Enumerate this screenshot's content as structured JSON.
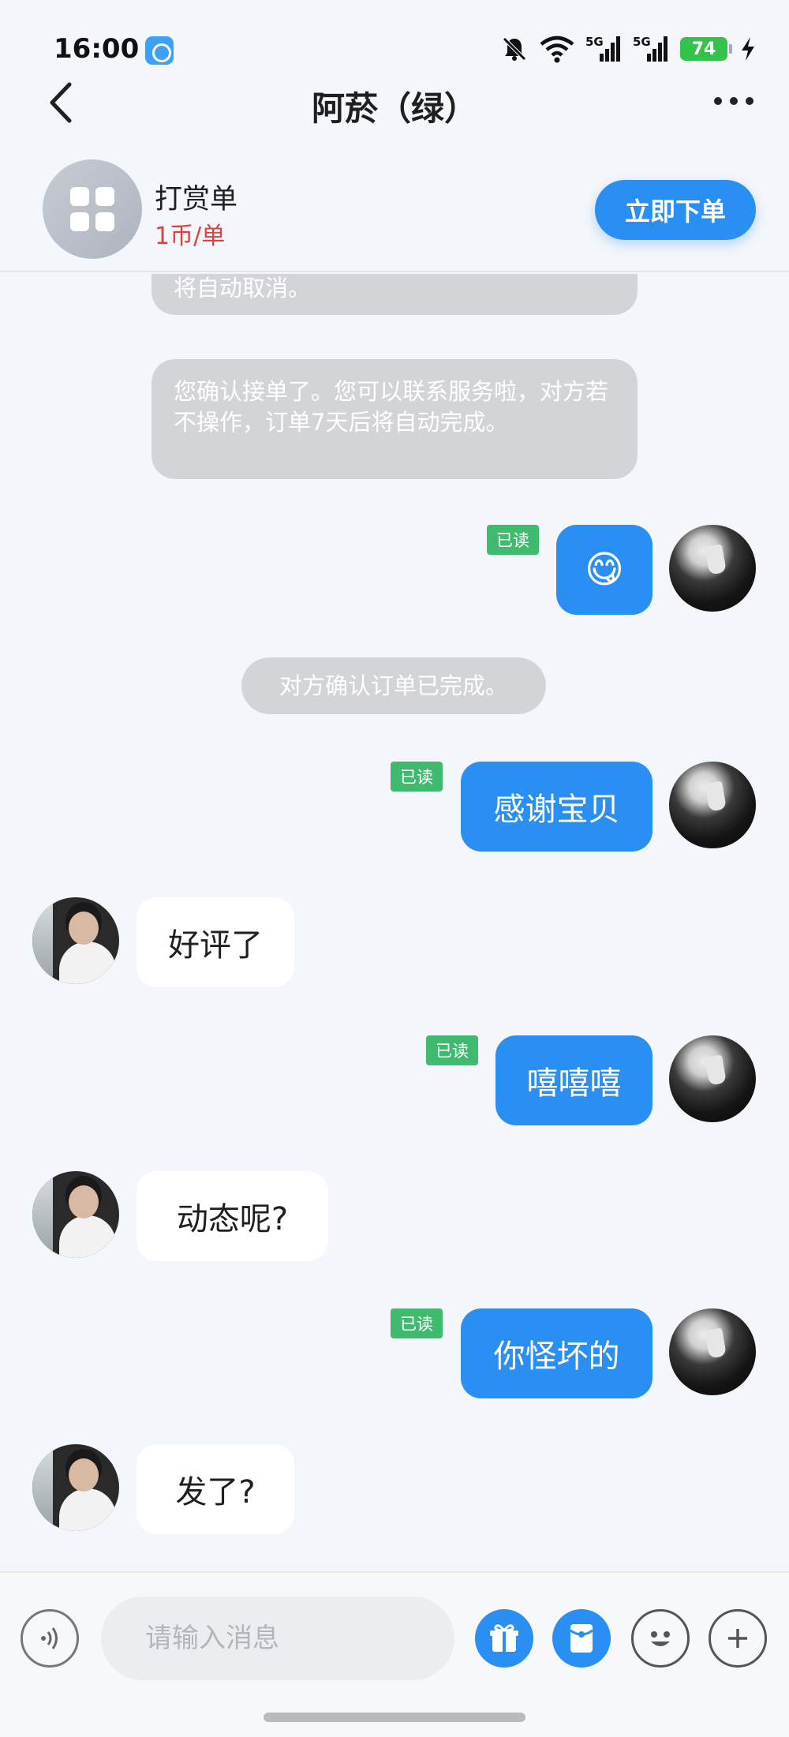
{
  "status_bar": {
    "time": "16:00",
    "signal_1": "5G",
    "signal_2": "5G",
    "battery": "74"
  },
  "header": {
    "title": "阿菸（绿）"
  },
  "service": {
    "name": "打赏单",
    "price": "1币/单",
    "order_button": "立即下单"
  },
  "messages": {
    "sys_cut": "将自动取消。",
    "sys_confirm": "您确认接单了。您可以联系服务啦，对方若不操作，订单7天后将自动完成。",
    "msg1_emoji": "😋",
    "sys_done": "对方确认订单已完成。",
    "msg2": "感谢宝贝",
    "msg3": "好评了",
    "msg4": "嘻嘻嘻",
    "msg5": "动态呢?",
    "msg6": "你怪坏的",
    "msg7": "发了?",
    "read_label": "已读"
  },
  "input": {
    "placeholder": "请输入消息"
  },
  "colors": {
    "accent": "#2a8ff3",
    "read_badge": "#3fba6e",
    "price": "#e0403e",
    "background": "#f3f6fa"
  }
}
